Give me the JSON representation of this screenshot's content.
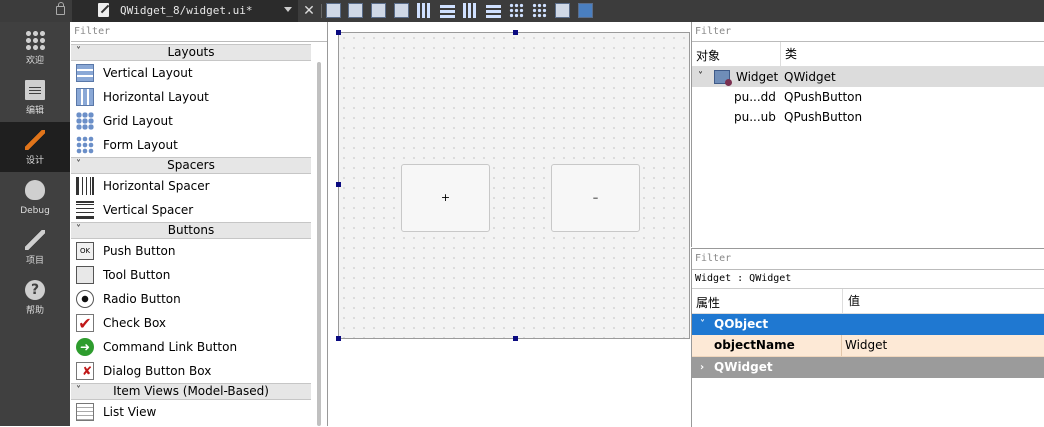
{
  "toolbar": {
    "file_name": "QWidget_8/widget.ui*",
    "close_glyph": "✕",
    "icons": [
      "edit-widgets-icon",
      "edit-signals-icon",
      "edit-buddies-icon",
      "edit-tab-order-icon",
      "layout-horizontal-icon",
      "layout-vertical-icon",
      "layout-horizontal-splitter-icon",
      "layout-vertical-splitter-icon",
      "layout-form-icon",
      "layout-grid-icon",
      "break-layout-icon",
      "adjust-size-icon"
    ]
  },
  "modes": [
    {
      "label": "欢迎",
      "icon": "welcome-icon"
    },
    {
      "label": "编辑",
      "icon": "edit-icon"
    },
    {
      "label": "设计",
      "icon": "design-icon",
      "active": true
    },
    {
      "label": "Debug",
      "icon": "debug-icon"
    },
    {
      "label": "项目",
      "icon": "projects-icon"
    },
    {
      "label": "帮助",
      "icon": "help-icon"
    }
  ],
  "widget_box": {
    "filter_placeholder": "Filter",
    "categories": {
      "layouts": "Layouts",
      "spacers": "Spacers",
      "buttons": "Buttons",
      "item_views": "Item Views (Model-Based)"
    },
    "items": {
      "vertical_layout": "Vertical Layout",
      "horizontal_layout": "Horizontal Layout",
      "grid_layout": "Grid Layout",
      "form_layout": "Form Layout",
      "horizontal_spacer": "Horizontal Spacer",
      "vertical_spacer": "Vertical Spacer",
      "push_button": "Push Button",
      "tool_button": "Tool Button",
      "radio_button": "Radio Button",
      "check_box": "Check Box",
      "command_link_button": "Command Link Button",
      "dialog_button_box": "Dialog Button Box",
      "list_view": "List View"
    },
    "push_button_icon_text": "OK",
    "collapse_glyph": "˅"
  },
  "form": {
    "button_add_label": "+",
    "button_sub_label": "–"
  },
  "object_inspector": {
    "filter_placeholder": "Filter",
    "col_object": "对象",
    "col_class": "类",
    "rows": [
      {
        "name": "Widget",
        "class": "QWidget"
      },
      {
        "name": "pu...dd",
        "class": "QPushButton"
      },
      {
        "name": "pu...ub",
        "class": "QPushButton"
      }
    ],
    "expand_glyph": "˅"
  },
  "property_editor": {
    "filter_placeholder": "Filter",
    "class_line": "Widget : QWidget",
    "col_property": "属性",
    "col_value": "值",
    "group_qobject": "QObject",
    "group_qwidget": "QWidget",
    "object_name_label": "objectName",
    "object_name_value": "Widget",
    "expand_glyph": "˅",
    "collapsed_glyph": "›"
  },
  "colors": {
    "accent": "#1f78d1",
    "selected_row": "#fde9d6",
    "dark_bar": "#3c3c3c"
  }
}
